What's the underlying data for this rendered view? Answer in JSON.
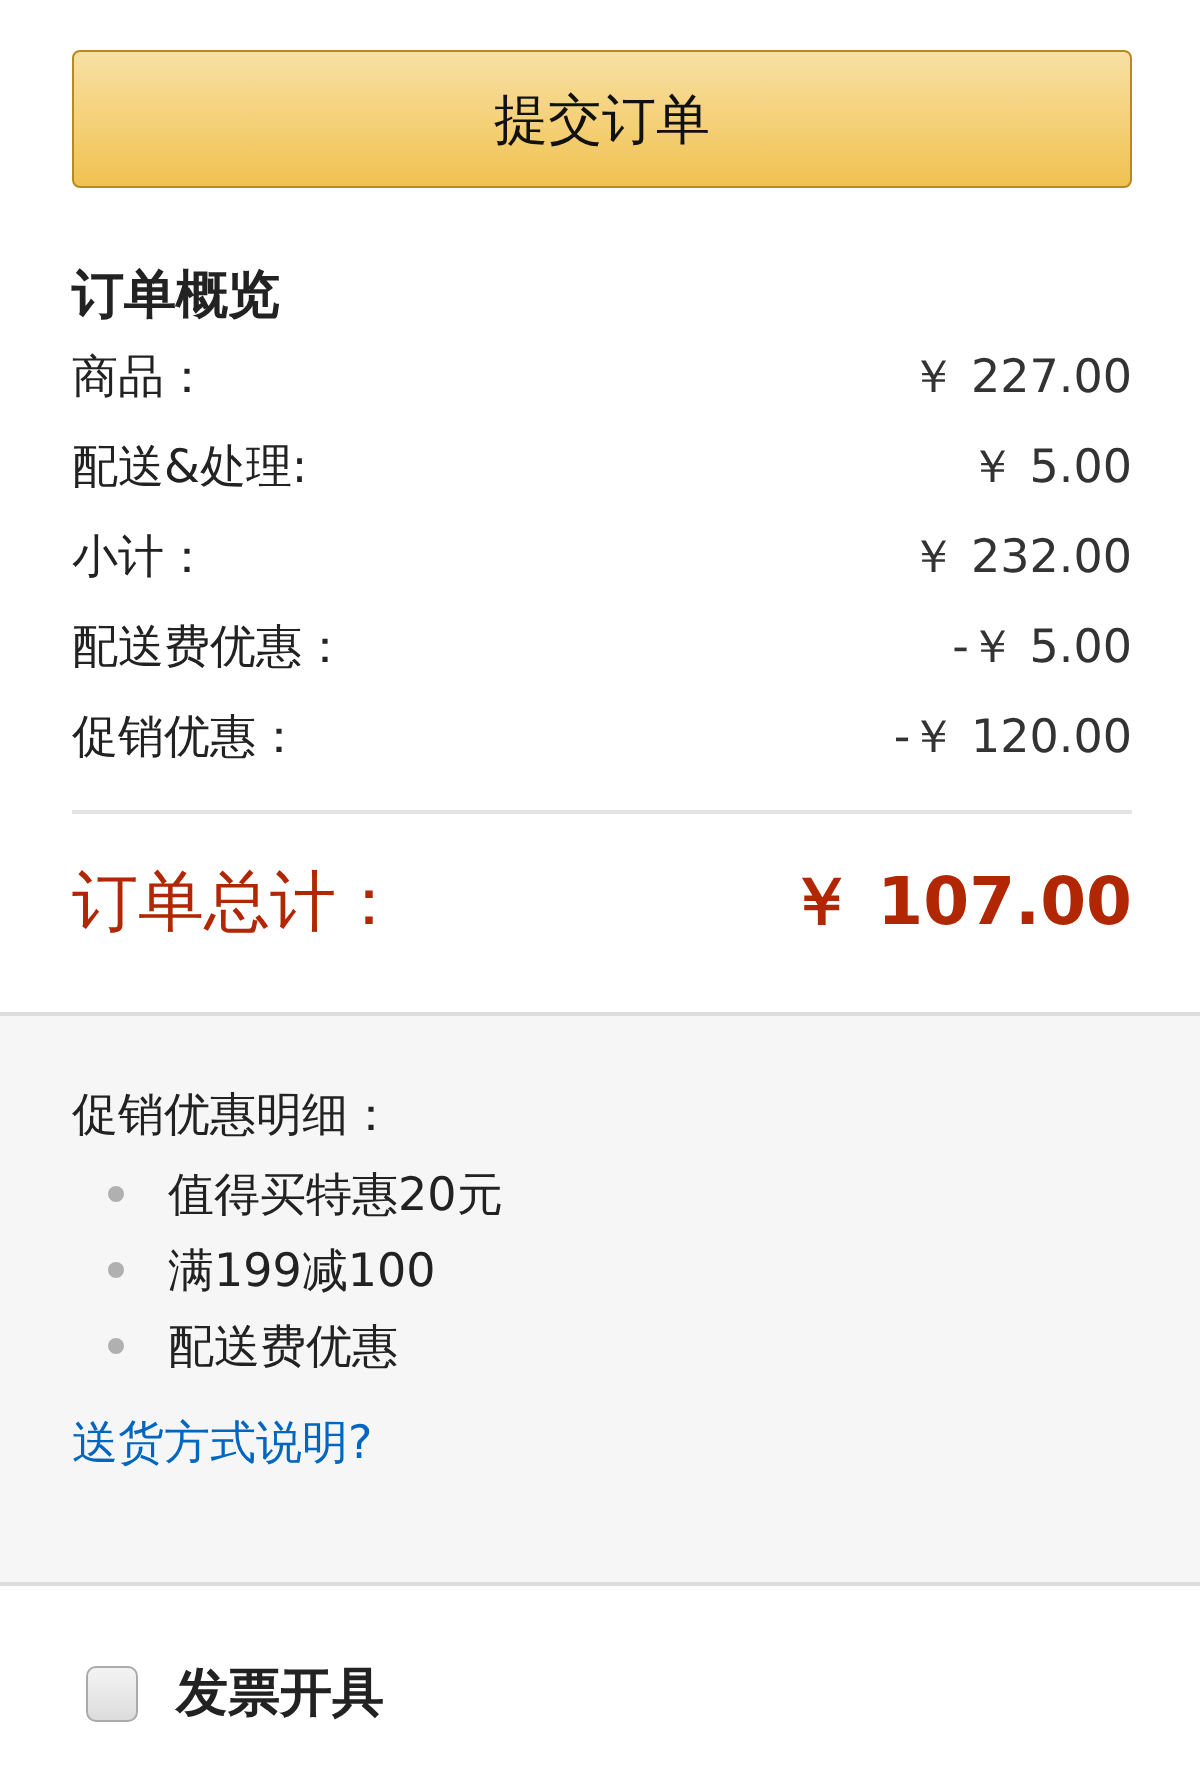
{
  "submit_button": {
    "label": "提交订单"
  },
  "order_summary": {
    "title": "订单概览",
    "rows": [
      {
        "label": "商品：",
        "amount": "￥ 227.00"
      },
      {
        "label": "配送&处理:",
        "amount": "￥ 5.00"
      },
      {
        "label": "小计：",
        "amount": "￥ 232.00"
      },
      {
        "label": "配送费优惠：",
        "amount": "-￥ 5.00"
      },
      {
        "label": "促销优惠：",
        "amount": "-￥ 120.00"
      }
    ],
    "total": {
      "label": "订单总计：",
      "amount": "￥ 107.00"
    }
  },
  "promotion_details": {
    "title": "促销优惠明细：",
    "items": [
      "值得买特惠20元",
      "满199减100",
      "配送费优惠"
    ],
    "link": "送货方式说明?"
  },
  "invoice": {
    "label": "发票开具",
    "checked": false
  }
}
